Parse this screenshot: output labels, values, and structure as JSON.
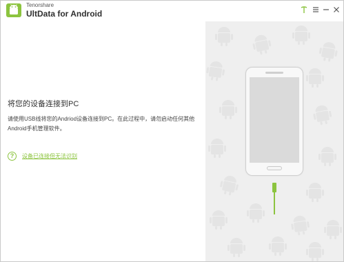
{
  "titlebar": {
    "brand": "Tenorshare",
    "app_title": "UltData for Android",
    "logo_icon": "android-logo-icon",
    "controls": [
      {
        "name": "pin-icon"
      },
      {
        "name": "menu-icon"
      },
      {
        "name": "minimize-icon"
      },
      {
        "name": "close-icon"
      }
    ]
  },
  "main": {
    "heading": "将您的设备连接到PC",
    "description": "请使用USB线将您的Andriod设备连接到PC。在此过程中，请勿启动任何其他Android手机管理软件。",
    "help_link": {
      "icon_text": "?",
      "label": "设备已连接但无法识别"
    }
  },
  "illustration": {
    "device_icon": "smartphone-icon",
    "cable_icon": "usb-cable-icon",
    "pattern_icon": "android-robot-icon"
  },
  "colors": {
    "accent": "#8cc43f",
    "panel_bg": "#efefef",
    "text": "#333333"
  }
}
